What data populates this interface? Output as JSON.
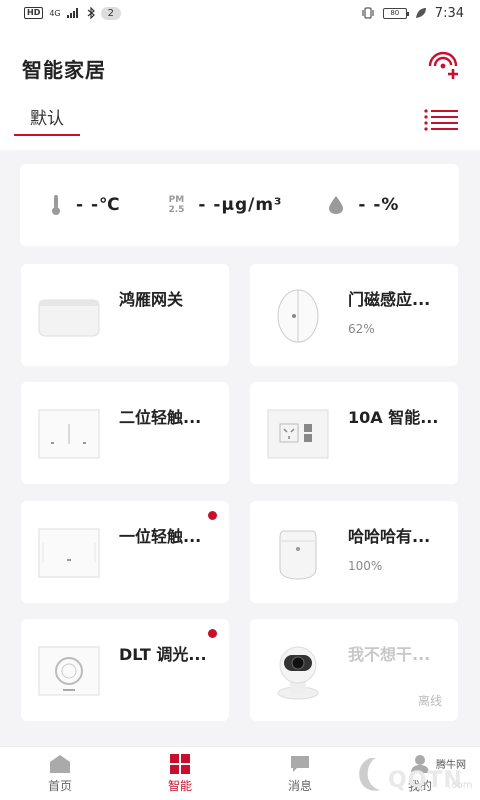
{
  "status_bar": {
    "hd": "HD",
    "signal": "4G",
    "notif_count": "2",
    "battery": "80",
    "time": "7:34"
  },
  "header": {
    "title": "智能家居",
    "tab_label": "默认"
  },
  "sensors": {
    "temperature": "- -℃",
    "pm_label_top": "PM",
    "pm_label_bottom": "2.5",
    "pm25": "- -μg/m³",
    "humidity": "- -%"
  },
  "devices": [
    {
      "name": "鸿雁网关",
      "status": "",
      "icon": "gateway-icon"
    },
    {
      "name": "门磁感应...",
      "status": "62%",
      "icon": "door-sensor-icon"
    },
    {
      "name": "二位轻触...",
      "status": "",
      "icon": "two-gang-switch-icon"
    },
    {
      "name": "10A 智能...",
      "status": "",
      "icon": "smart-socket-icon"
    },
    {
      "name": "一位轻触...",
      "status": "",
      "icon": "one-gang-switch-icon",
      "alert": true
    },
    {
      "name": "哈哈哈有...",
      "status": "100%",
      "icon": "motion-sensor-icon"
    },
    {
      "name": "DLT 调光...",
      "status": "",
      "icon": "dimmer-icon",
      "alert": true
    },
    {
      "name": "我不想干...",
      "status": "离线",
      "icon": "camera-icon",
      "offline": true
    }
  ],
  "nav": {
    "items": [
      {
        "label": "首页",
        "icon": "home-icon"
      },
      {
        "label": "智能",
        "icon": "grid-icon",
        "active": true
      },
      {
        "label": "消息",
        "icon": "message-icon"
      },
      {
        "label": "我的",
        "icon": "profile-icon"
      }
    ]
  },
  "watermark": {
    "site": "腾牛网",
    "brand": "QQTN",
    "domain": ".com"
  },
  "colors": {
    "accent": "#c8102e",
    "background": "#f4f4f6"
  }
}
